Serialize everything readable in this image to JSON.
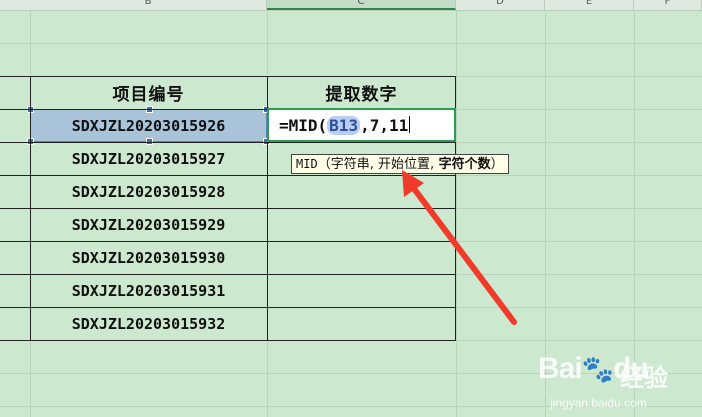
{
  "columns": [
    {
      "letter": "B",
      "active": false
    },
    {
      "letter": "C",
      "active": true
    },
    {
      "letter": "D",
      "active": false
    },
    {
      "letter": "E",
      "active": false
    },
    {
      "letter": "F",
      "active": false
    }
  ],
  "table": {
    "headers": [
      "项目编号",
      "提取数字"
    ],
    "rows": [
      "SDXJZL20203015926",
      "SDXJZL20203015927",
      "SDXJZL20203015928",
      "SDXJZL20203015929",
      "SDXJZL20203015930",
      "SDXJZL20203015931",
      "SDXJZL20203015932"
    ]
  },
  "editor": {
    "prefix": "=MID(",
    "ref": "B13",
    "suffix": ",7,11"
  },
  "tooltip": {
    "fn": "MID",
    "open": "（字符串,",
    "arg2": " 开始位置,",
    "arg3": " 字符个数",
    "close": "）"
  },
  "annotation": {
    "arrow_color": "#f03a2a"
  },
  "watermark": {
    "logo": "Bai",
    "logo_tail": "du",
    "cn": "经验",
    "url": "jingyan.baidu.com"
  }
}
